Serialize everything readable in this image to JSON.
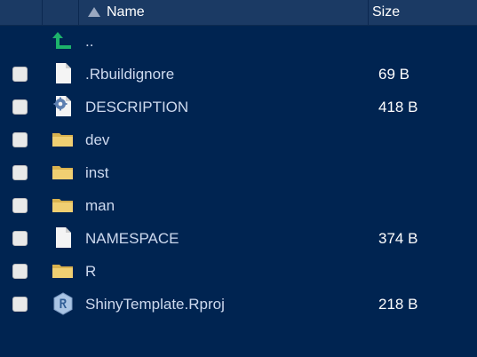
{
  "header": {
    "name_label": "Name",
    "size_label": "Size"
  },
  "rows": [
    {
      "name": "..",
      "size": "",
      "checkbox": false,
      "icon": "up-arrow-icon"
    },
    {
      "name": ".Rbuildignore",
      "size": "69 B",
      "checkbox": true,
      "icon": "file-icon"
    },
    {
      "name": "DESCRIPTION",
      "size": "418 B",
      "checkbox": true,
      "icon": "gear-file-icon"
    },
    {
      "name": "dev",
      "size": "",
      "checkbox": true,
      "icon": "folder-icon"
    },
    {
      "name": "inst",
      "size": "",
      "checkbox": true,
      "icon": "folder-icon"
    },
    {
      "name": "man",
      "size": "",
      "checkbox": true,
      "icon": "folder-icon"
    },
    {
      "name": "NAMESPACE",
      "size": "374 B",
      "checkbox": true,
      "icon": "file-icon"
    },
    {
      "name": "R",
      "size": "",
      "checkbox": true,
      "icon": "folder-icon"
    },
    {
      "name": "ShinyTemplate.Rproj",
      "size": "218 B",
      "checkbox": true,
      "icon": "rproj-icon"
    }
  ],
  "colors": {
    "background": "#002451",
    "header": "#1b3a64",
    "text": "#cdd9ee",
    "folder": "#e8c46a",
    "up_arrow": "#1db36b"
  }
}
